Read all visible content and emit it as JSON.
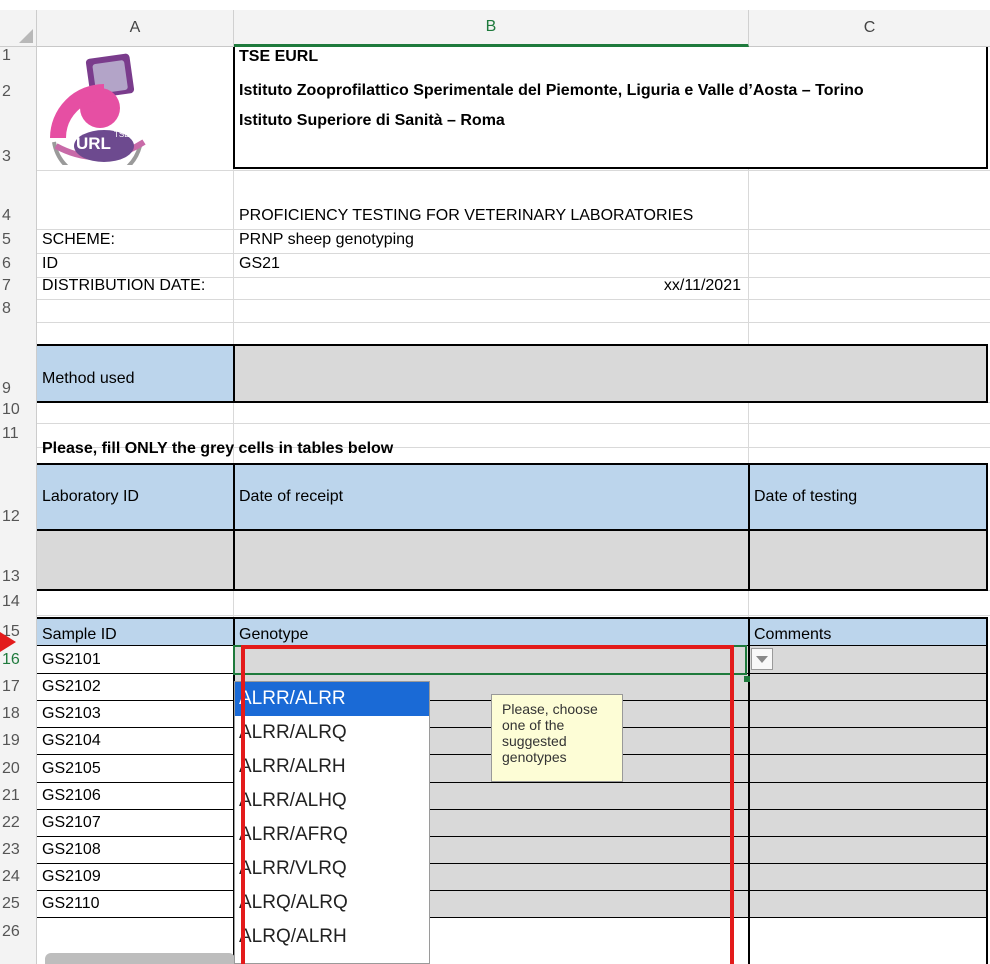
{
  "columns": [
    "A",
    "B",
    "C"
  ],
  "rows": [
    "1",
    "2",
    "3",
    "4",
    "5",
    "6",
    "7",
    "8",
    "9",
    "10",
    "11",
    "12",
    "13",
    "14",
    "15",
    "16",
    "17",
    "18",
    "19",
    "20",
    "21",
    "22",
    "23",
    "24",
    "25",
    "26"
  ],
  "header": {
    "line1": "TSE EURL",
    "line2": "Istituto Zooprofilattico Sperimentale del Piemonte, Liguria e Valle d’Aosta – Torino",
    "line3": "Istituto Superiore di Sanità – Roma",
    "logo_text": "URL",
    "logo_sup": "TSE"
  },
  "info": {
    "title": "PROFICIENCY TESTING FOR VETERINARY LABORATORIES",
    "scheme_label": "SCHEME:",
    "scheme_value": "PRNP sheep genotyping",
    "id_label": "ID",
    "id_value": "GS21",
    "date_label": "DISTRIBUTION DATE:",
    "date_value": "xx/11/2021"
  },
  "method_label": "Method used",
  "instruction": "Please, fill ONLY the grey cells in tables below",
  "lab_table": {
    "col1": "Laboratory ID",
    "col2": "Date of receipt",
    "col3": "Date of testing"
  },
  "sample_table": {
    "col1": "Sample ID",
    "col2": "Genotype",
    "col3": "Comments",
    "samples": [
      "GS2101",
      "GS2102",
      "GS2103",
      "GS2104",
      "GS2105",
      "GS2106",
      "GS2107",
      "GS2108",
      "GS2109",
      "GS2110"
    ]
  },
  "dropdown": {
    "options": [
      "ALRR/ALRR",
      "ALRR/ALRQ",
      "ALRR/ALRH",
      "ALRR/ALHQ",
      "ALRR/AFRQ",
      "ALRR/VLRQ",
      "ALRQ/ALRQ",
      "ALRQ/ALRH"
    ],
    "selected_index": 0
  },
  "tooltip": "Please, choose one of the suggested genotypes",
  "colors": {
    "header_blue": "#bcd5ec",
    "input_grey": "#d9d9d9",
    "highlight_red": "#e31b1b",
    "selection_green": "#1e7a3c",
    "dropdown_selected": "#1a6ad6",
    "tooltip_bg": "#fdfdd6"
  }
}
